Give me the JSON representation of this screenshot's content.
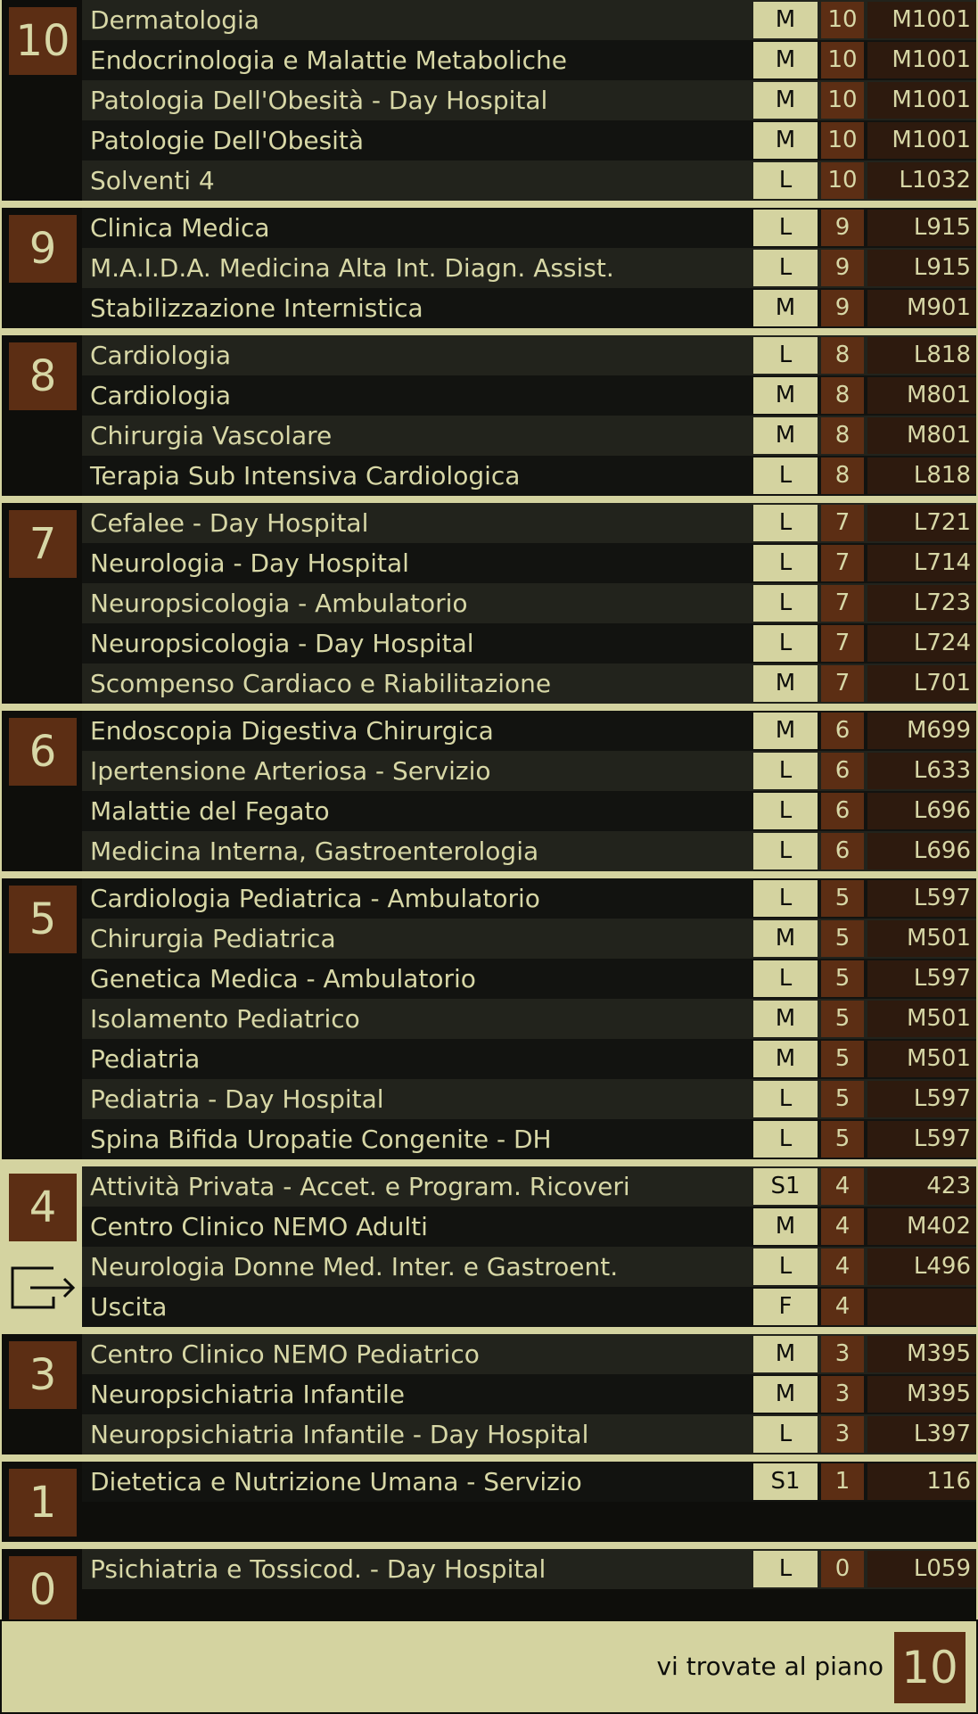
{
  "sections": [
    {
      "floor": "10",
      "rows": [
        {
          "name": "Dermatologia",
          "building": "M",
          "floor": "10",
          "code": "M1001"
        },
        {
          "name": "Endocrinologia e Malattie Metaboliche",
          "building": "M",
          "floor": "10",
          "code": "M1001"
        },
        {
          "name": "Patologia Dell'Obesità - Day Hospital",
          "building": "M",
          "floor": "10",
          "code": "M1001"
        },
        {
          "name": "Patologie Dell'Obesità",
          "building": "M",
          "floor": "10",
          "code": "M1001"
        },
        {
          "name": "Solventi 4",
          "building": "L",
          "floor": "10",
          "code": "L1032"
        }
      ]
    },
    {
      "floor": "9",
      "rows": [
        {
          "name": "Clinica Medica",
          "building": "L",
          "floor": "9",
          "code": "L915"
        },
        {
          "name": "M.A.I.D.A. Medicina Alta Int. Diagn. Assist.",
          "building": "L",
          "floor": "9",
          "code": "L915"
        },
        {
          "name": "Stabilizzazione Internistica",
          "building": "M",
          "floor": "9",
          "code": "M901"
        }
      ]
    },
    {
      "floor": "8",
      "rows": [
        {
          "name": "Cardiologia",
          "building": "L",
          "floor": "8",
          "code": "L818"
        },
        {
          "name": "Cardiologia",
          "building": "M",
          "floor": "8",
          "code": "M801"
        },
        {
          "name": "Chirurgia Vascolare",
          "building": "M",
          "floor": "8",
          "code": "M801"
        },
        {
          "name": "Terapia Sub Intensiva Cardiologica",
          "building": "L",
          "floor": "8",
          "code": "L818"
        }
      ]
    },
    {
      "floor": "7",
      "rows": [
        {
          "name": "Cefalee - Day Hospital",
          "building": "L",
          "floor": "7",
          "code": "L721"
        },
        {
          "name": "Neurologia - Day Hospital",
          "building": "L",
          "floor": "7",
          "code": "L714"
        },
        {
          "name": "Neuropsicologia - Ambulatorio",
          "building": "L",
          "floor": "7",
          "code": "L723"
        },
        {
          "name": "Neuropsicologia - Day Hospital",
          "building": "L",
          "floor": "7",
          "code": "L724"
        },
        {
          "name": "Scompenso Cardiaco e Riabilitazione",
          "building": "M",
          "floor": "7",
          "code": "L701"
        }
      ]
    },
    {
      "floor": "6",
      "rows": [
        {
          "name": "Endoscopia Digestiva Chirurgica",
          "building": "M",
          "floor": "6",
          "code": "M699"
        },
        {
          "name": "Ipertensione Arteriosa - Servizio",
          "building": "L",
          "floor": "6",
          "code": "L633"
        },
        {
          "name": "Malattie del Fegato",
          "building": "L",
          "floor": "6",
          "code": "L696"
        },
        {
          "name": "Medicina Interna, Gastroenterologia",
          "building": "L",
          "floor": "6",
          "code": "L696"
        }
      ]
    },
    {
      "floor": "5",
      "rows": [
        {
          "name": "Cardiologia Pediatrica - Ambulatorio",
          "building": "L",
          "floor": "5",
          "code": "L597"
        },
        {
          "name": "Chirurgia Pediatrica",
          "building": "M",
          "floor": "5",
          "code": "M501"
        },
        {
          "name": "Genetica Medica - Ambulatorio",
          "building": "L",
          "floor": "5",
          "code": "L597"
        },
        {
          "name": "Isolamento Pediatrico",
          "building": "M",
          "floor": "5",
          "code": "M501"
        },
        {
          "name": "Pediatria",
          "building": "M",
          "floor": "5",
          "code": "M501"
        },
        {
          "name": "Pediatria - Day Hospital",
          "building": "L",
          "floor": "5",
          "code": "L597"
        },
        {
          "name": "Spina Bifida Uropatie Congenite - DH",
          "building": "L",
          "floor": "5",
          "code": "L597"
        }
      ]
    },
    {
      "floor": "4",
      "current": true,
      "rows": [
        {
          "name": "Attività Privata - Accet. e Program. Ricoveri",
          "building": "S1",
          "floor": "4",
          "code": "423"
        },
        {
          "name": "Centro Clinico NEMO Adulti",
          "building": "M",
          "floor": "4",
          "code": "M402"
        },
        {
          "name": "Neurologia Donne Med. Inter. e Gastroent.",
          "building": "L",
          "floor": "4",
          "code": "L496"
        },
        {
          "name": "Uscita",
          "building": "F",
          "floor": "4",
          "code": ""
        }
      ]
    },
    {
      "floor": "3",
      "rows": [
        {
          "name": "Centro Clinico NEMO Pediatrico",
          "building": "M",
          "floor": "3",
          "code": "M395"
        },
        {
          "name": "Neuropsichiatria Infantile",
          "building": "M",
          "floor": "3",
          "code": "M395"
        },
        {
          "name": "Neuropsichiatria Infantile - Day Hospital",
          "building": "L",
          "floor": "3",
          "code": "L397"
        }
      ]
    },
    {
      "floor": "1",
      "filler": true,
      "rows": [
        {
          "name": "Dietetica e Nutrizione Umana - Servizio",
          "building": "S1",
          "floor": "1",
          "code": "116"
        }
      ]
    },
    {
      "floor": "0",
      "filler": true,
      "rows": [
        {
          "name": "Psichiatria e Tossicod. - Day Hospital",
          "building": "L",
          "floor": "0",
          "code": "L059"
        }
      ]
    }
  ],
  "footer": {
    "text": "vi trovate al piano",
    "floor": "10"
  },
  "icons": {
    "exit": "exit-arrow-icon"
  },
  "colors": {
    "accent": "#5c2e14",
    "light": "#d4d3a0",
    "background": "#0e0e0b"
  }
}
